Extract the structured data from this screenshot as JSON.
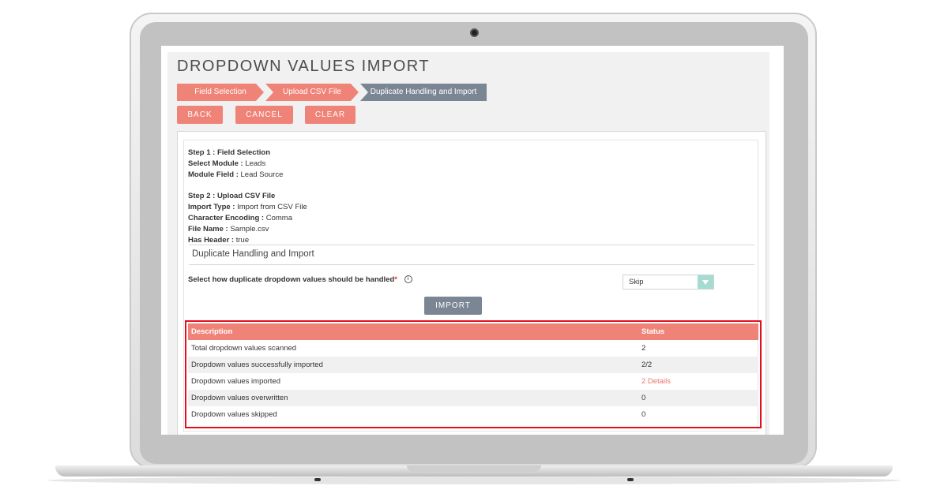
{
  "page": {
    "title": "DROPDOWN VALUES IMPORT",
    "steps": [
      "Field Selection",
      "Upload CSV File",
      "Duplicate Handling and Import"
    ],
    "buttons": {
      "back": "BACK",
      "cancel": "CANCEL",
      "clear": "CLEAR",
      "import": "IMPORT"
    }
  },
  "summary": {
    "step1": {
      "heading": "Step 1 : Field Selection",
      "module_label": "Select Module :",
      "module_value": "Leads",
      "field_label": "Module Field :",
      "field_value": "Lead Source"
    },
    "step2": {
      "heading": "Step 2 : Upload CSV File",
      "import_type_label": "Import Type :",
      "import_type_value": "Import from CSV File",
      "encoding_label": "Character Encoding :",
      "encoding_value": "Comma",
      "file_label": "File Name :",
      "file_value": "Sample.csv",
      "header_label": "Has Header :",
      "header_value": "true"
    }
  },
  "duplicate": {
    "section_title": "Duplicate Handling and Import",
    "question": "Select how duplicate dropdown values should be handled",
    "required_mark": "*",
    "info_glyph": "i",
    "select_value": "Skip"
  },
  "results": {
    "headers": {
      "description": "Description",
      "status": "Status"
    },
    "rows": [
      {
        "description": "Total dropdown values scanned",
        "status": "2"
      },
      {
        "description": "Dropdown values successfully imported",
        "status": "2/2"
      },
      {
        "description": "Dropdown values imported",
        "status": "2 Details"
      },
      {
        "description": "Dropdown values overwritten",
        "status": "0"
      },
      {
        "description": "Dropdown values skipped",
        "status": "0"
      }
    ]
  },
  "colors": {
    "accent": "#f08377",
    "active_step": "#7b8694",
    "highlight_border": "#e2101f",
    "select_arrow": "#a6dbd1"
  }
}
